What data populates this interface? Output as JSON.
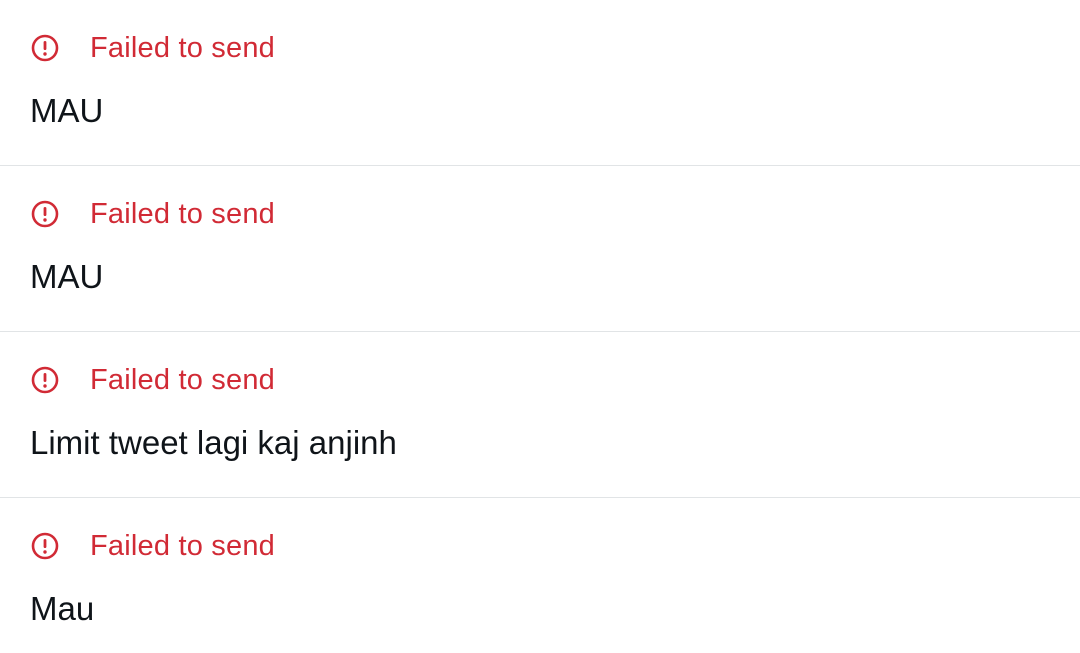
{
  "colors": {
    "error": "#d12a35",
    "text": "#0f1419",
    "divider": "#e1e4e6",
    "background": "#ffffff"
  },
  "messages": [
    {
      "status_icon": "error-circle-icon",
      "status": "Failed to send",
      "text": "MAU"
    },
    {
      "status_icon": "error-circle-icon",
      "status": "Failed to send",
      "text": "MAU"
    },
    {
      "status_icon": "error-circle-icon",
      "status": "Failed to send",
      "text": "Limit tweet lagi kaj anjinh"
    },
    {
      "status_icon": "error-circle-icon",
      "status": "Failed to send",
      "text": "Mau"
    }
  ]
}
